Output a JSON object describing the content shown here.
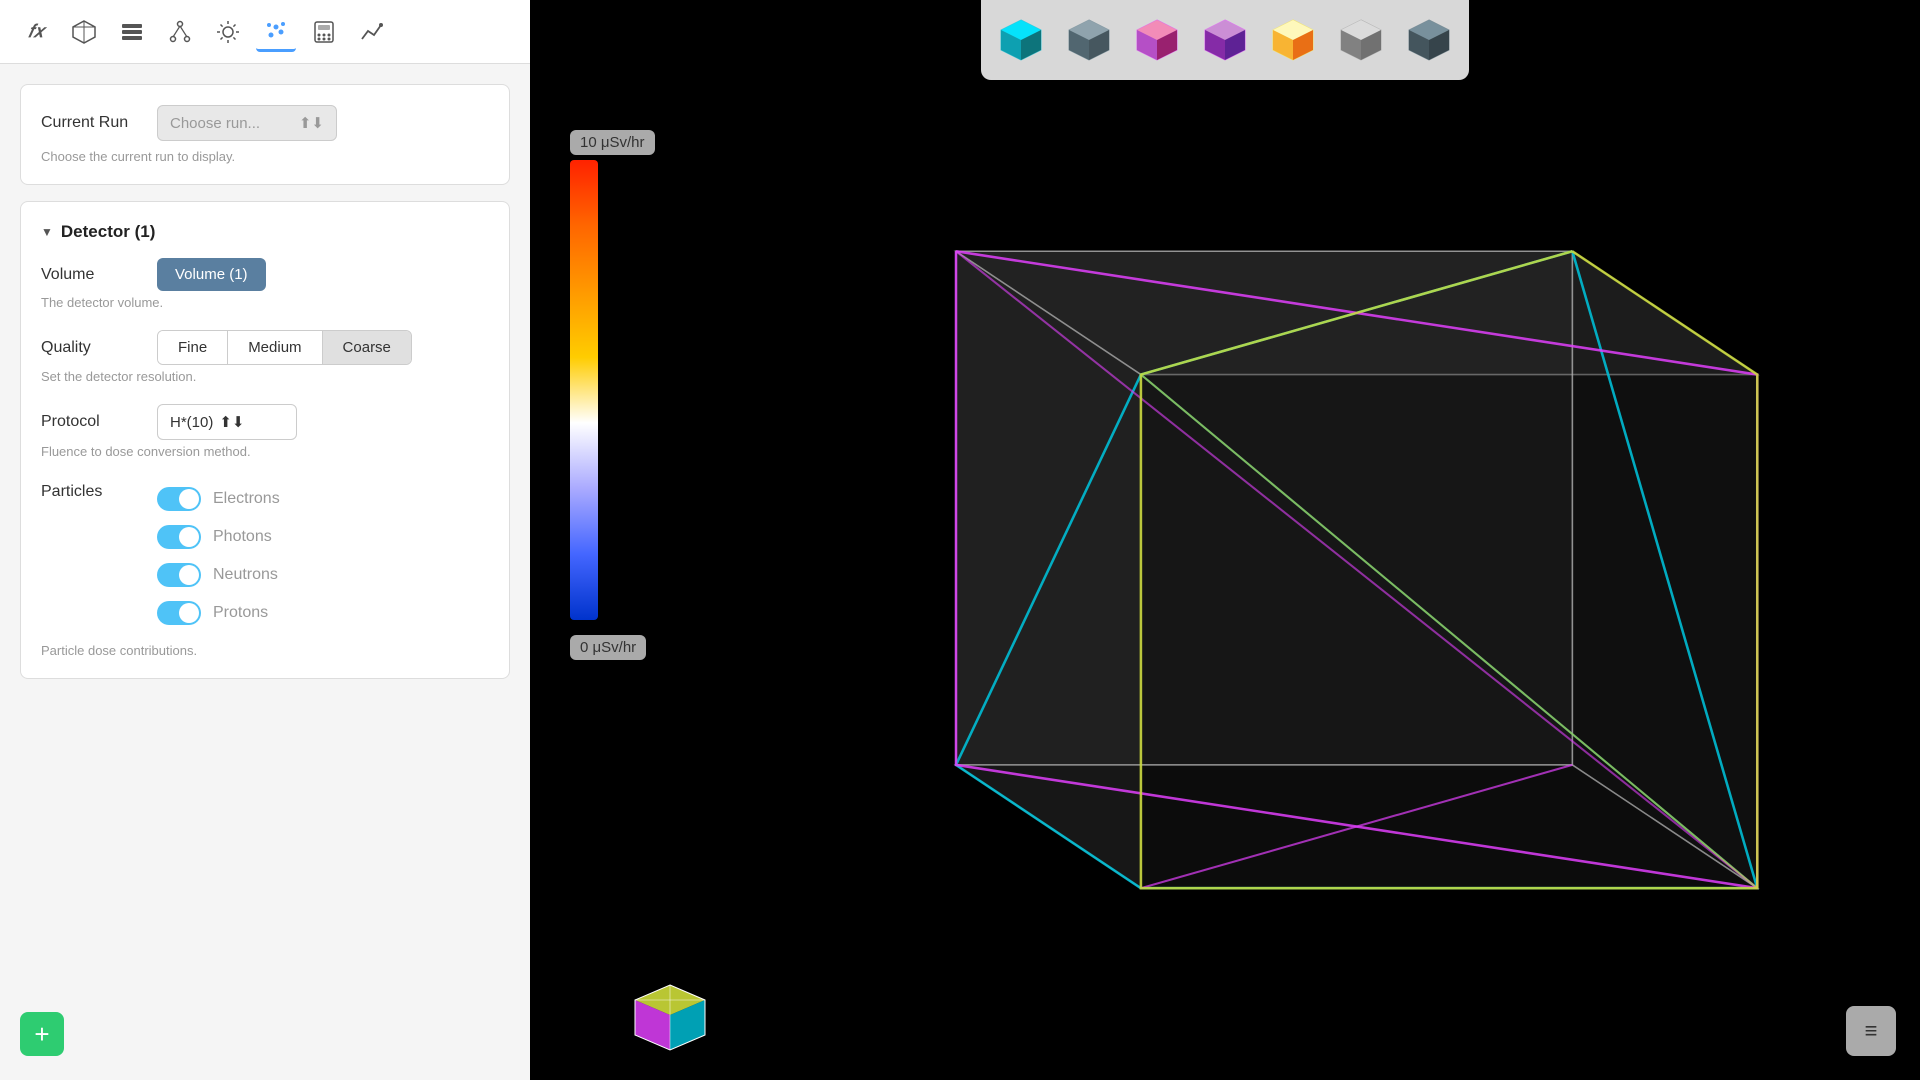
{
  "toolbar": {
    "icons": [
      {
        "name": "formula-icon",
        "symbol": "𝑓𝑥",
        "active": false
      },
      {
        "name": "cube-icon",
        "symbol": "⬡",
        "active": false
      },
      {
        "name": "layers-icon",
        "symbol": "▤",
        "active": false
      },
      {
        "name": "hierarchy-icon",
        "symbol": "⌥",
        "active": false
      },
      {
        "name": "sun-icon",
        "symbol": "✳",
        "active": false
      },
      {
        "name": "scatter-icon",
        "symbol": "⁘",
        "active": true
      },
      {
        "name": "calculator-icon",
        "symbol": "⊞",
        "active": false
      },
      {
        "name": "chart-icon",
        "symbol": "↗",
        "active": false
      }
    ]
  },
  "current_run": {
    "label": "Current Run",
    "placeholder": "Choose run...",
    "hint": "Choose the current run to display."
  },
  "detector": {
    "title": "Detector (1)",
    "volume": {
      "label": "Volume",
      "button_label": "Volume (1)",
      "hint": "The detector volume."
    },
    "quality": {
      "label": "Quality",
      "options": [
        "Fine",
        "Medium",
        "Coarse"
      ],
      "active": "Coarse",
      "hint": "Set the detector resolution."
    },
    "protocol": {
      "label": "Protocol",
      "value": "H*(10)",
      "hint": "Fluence to dose conversion method."
    },
    "particles": {
      "label": "Particles",
      "items": [
        {
          "name": "Electrons",
          "enabled": true
        },
        {
          "name": "Photons",
          "enabled": true
        },
        {
          "name": "Neutrons",
          "enabled": true
        },
        {
          "name": "Protons",
          "enabled": true
        }
      ],
      "hint": "Particle dose contributions."
    }
  },
  "scale": {
    "top_label": "10 μSv/hr",
    "bottom_label": "0 μSv/hr"
  },
  "add_button_label": "+",
  "menu_button_label": "≡"
}
